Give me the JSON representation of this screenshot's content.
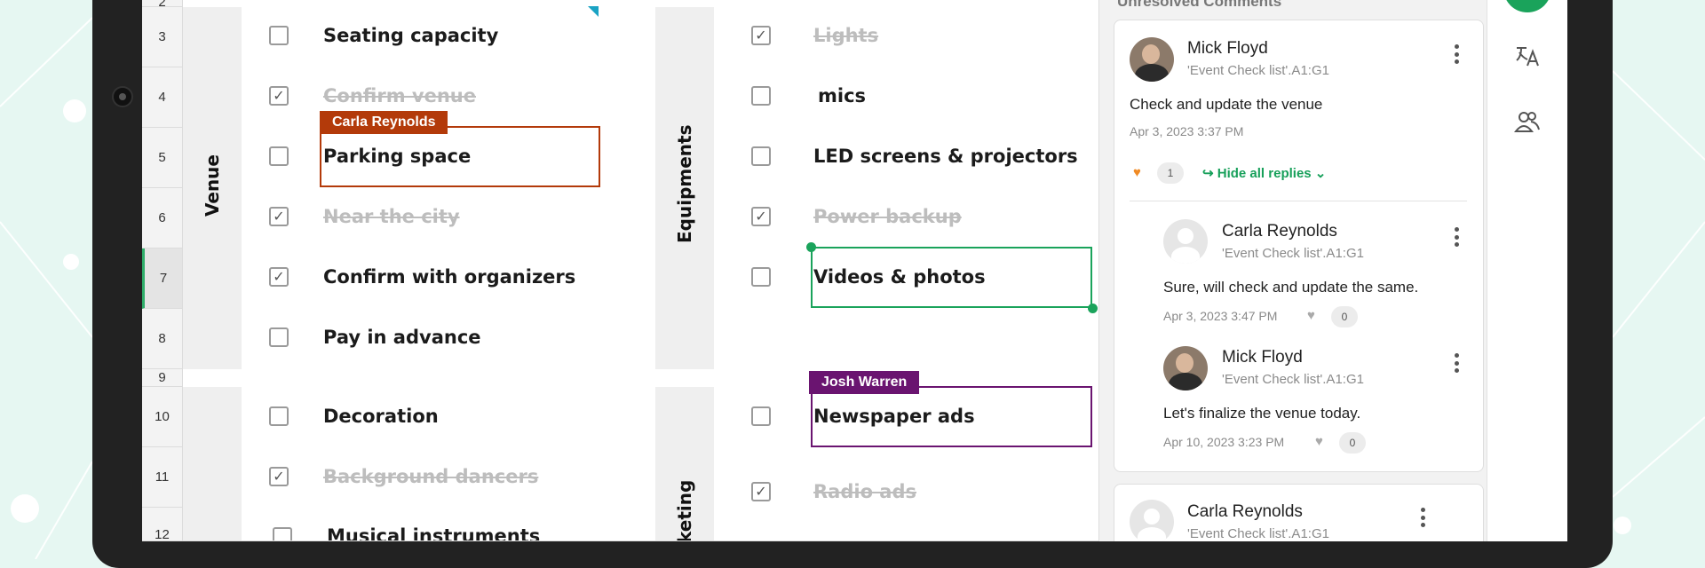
{
  "sheet": {
    "row_numbers": [
      "2",
      "3",
      "4",
      "5",
      "6",
      "7",
      "8",
      "9",
      "10",
      "11",
      "12"
    ],
    "active_row": "7",
    "groups": {
      "venue": "Venue",
      "equipments": "Equipments",
      "marketing_partial": "keting"
    },
    "left_items": [
      {
        "label": "Seating capacity",
        "checked": false,
        "done": false
      },
      {
        "label": "Confirm venue",
        "checked": true,
        "done": true
      },
      {
        "label": "Parking space",
        "checked": false,
        "done": false
      },
      {
        "label": "Near the city",
        "checked": true,
        "done": true
      },
      {
        "label": "Confirm with organizers",
        "checked": true,
        "done": false
      },
      {
        "label": "Pay in advance",
        "checked": false,
        "done": false
      },
      {
        "label": "Decoration",
        "checked": false,
        "done": false
      },
      {
        "label": "Background dancers",
        "checked": true,
        "done": true
      },
      {
        "label": "Musical instruments",
        "checked": false,
        "done": false
      }
    ],
    "right_items": [
      {
        "label": "Lights",
        "checked": true,
        "done": true
      },
      {
        "label": "mics",
        "checked": false,
        "done": false
      },
      {
        "label": "LED screens & projectors",
        "checked": false,
        "done": false
      },
      {
        "label": "Power backup",
        "checked": true,
        "done": true
      },
      {
        "label": "Videos & photos",
        "checked": false,
        "done": false
      },
      {
        "label": "Newspaper ads",
        "checked": false,
        "done": false
      },
      {
        "label": "Radio ads",
        "checked": true,
        "done": true
      }
    ],
    "collaborators": {
      "carla": {
        "name": "Carla Reynolds",
        "color": "#b33a0a"
      },
      "josh": {
        "name": "Josh Warren",
        "color": "#6a1470"
      }
    },
    "check_glyph": "✓"
  },
  "comments": {
    "title": "Unresolved Comments",
    "thread1": {
      "author": "Mick Floyd",
      "ref": "'Event Check list'.A1:G1",
      "text": "Check and update the venue",
      "time": "Apr 3, 2023 3:37 PM",
      "likes": "1",
      "hide_replies": "Hide all replies",
      "replies": [
        {
          "author": "Carla Reynolds",
          "ref": "'Event Check list'.A1:G1",
          "text": "Sure, will check and update the same.",
          "time": "Apr 3, 2023 3:47 PM",
          "likes": "0"
        },
        {
          "author": "Mick Floyd",
          "ref": "'Event Check list'.A1:G1",
          "text": "Let's finalize the venue today.",
          "time": "Apr 10, 2023 3:23 PM",
          "likes": "0"
        }
      ]
    },
    "thread2": {
      "author": "Carla Reynolds",
      "ref": "'Event Check list'.A1:G1"
    }
  },
  "colors": {
    "accent": "#1aa35b",
    "heart_active": "#f08a24"
  }
}
